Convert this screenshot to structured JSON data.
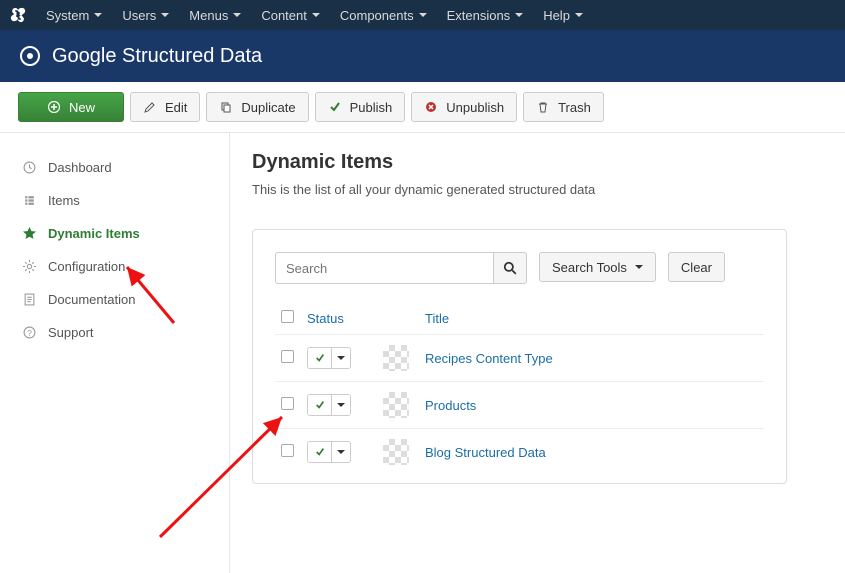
{
  "topmenu": [
    "System",
    "Users",
    "Menus",
    "Content",
    "Components",
    "Extensions",
    "Help"
  ],
  "header": {
    "title": "Google Structured Data"
  },
  "toolbar": {
    "new": "New",
    "edit": "Edit",
    "duplicate": "Duplicate",
    "publish": "Publish",
    "unpublish": "Unpublish",
    "trash": "Trash"
  },
  "sidebar": [
    {
      "icon": "clock",
      "label": "Dashboard"
    },
    {
      "icon": "list",
      "label": "Items"
    },
    {
      "icon": "star",
      "label": "Dynamic Items",
      "active": true
    },
    {
      "icon": "gear",
      "label": "Configuration"
    },
    {
      "icon": "doc",
      "label": "Documentation"
    },
    {
      "icon": "help",
      "label": "Support"
    }
  ],
  "main": {
    "title": "Dynamic Items",
    "subtitle": "This is the list of all your dynamic generated structured data"
  },
  "filters": {
    "search_placeholder": "Search",
    "tools": "Search Tools",
    "clear": "Clear"
  },
  "columns": {
    "status": "Status",
    "title": "Title"
  },
  "rows": [
    {
      "title": "Recipes Content Type"
    },
    {
      "title": "Products"
    },
    {
      "title": "Blog Structured Data"
    }
  ]
}
